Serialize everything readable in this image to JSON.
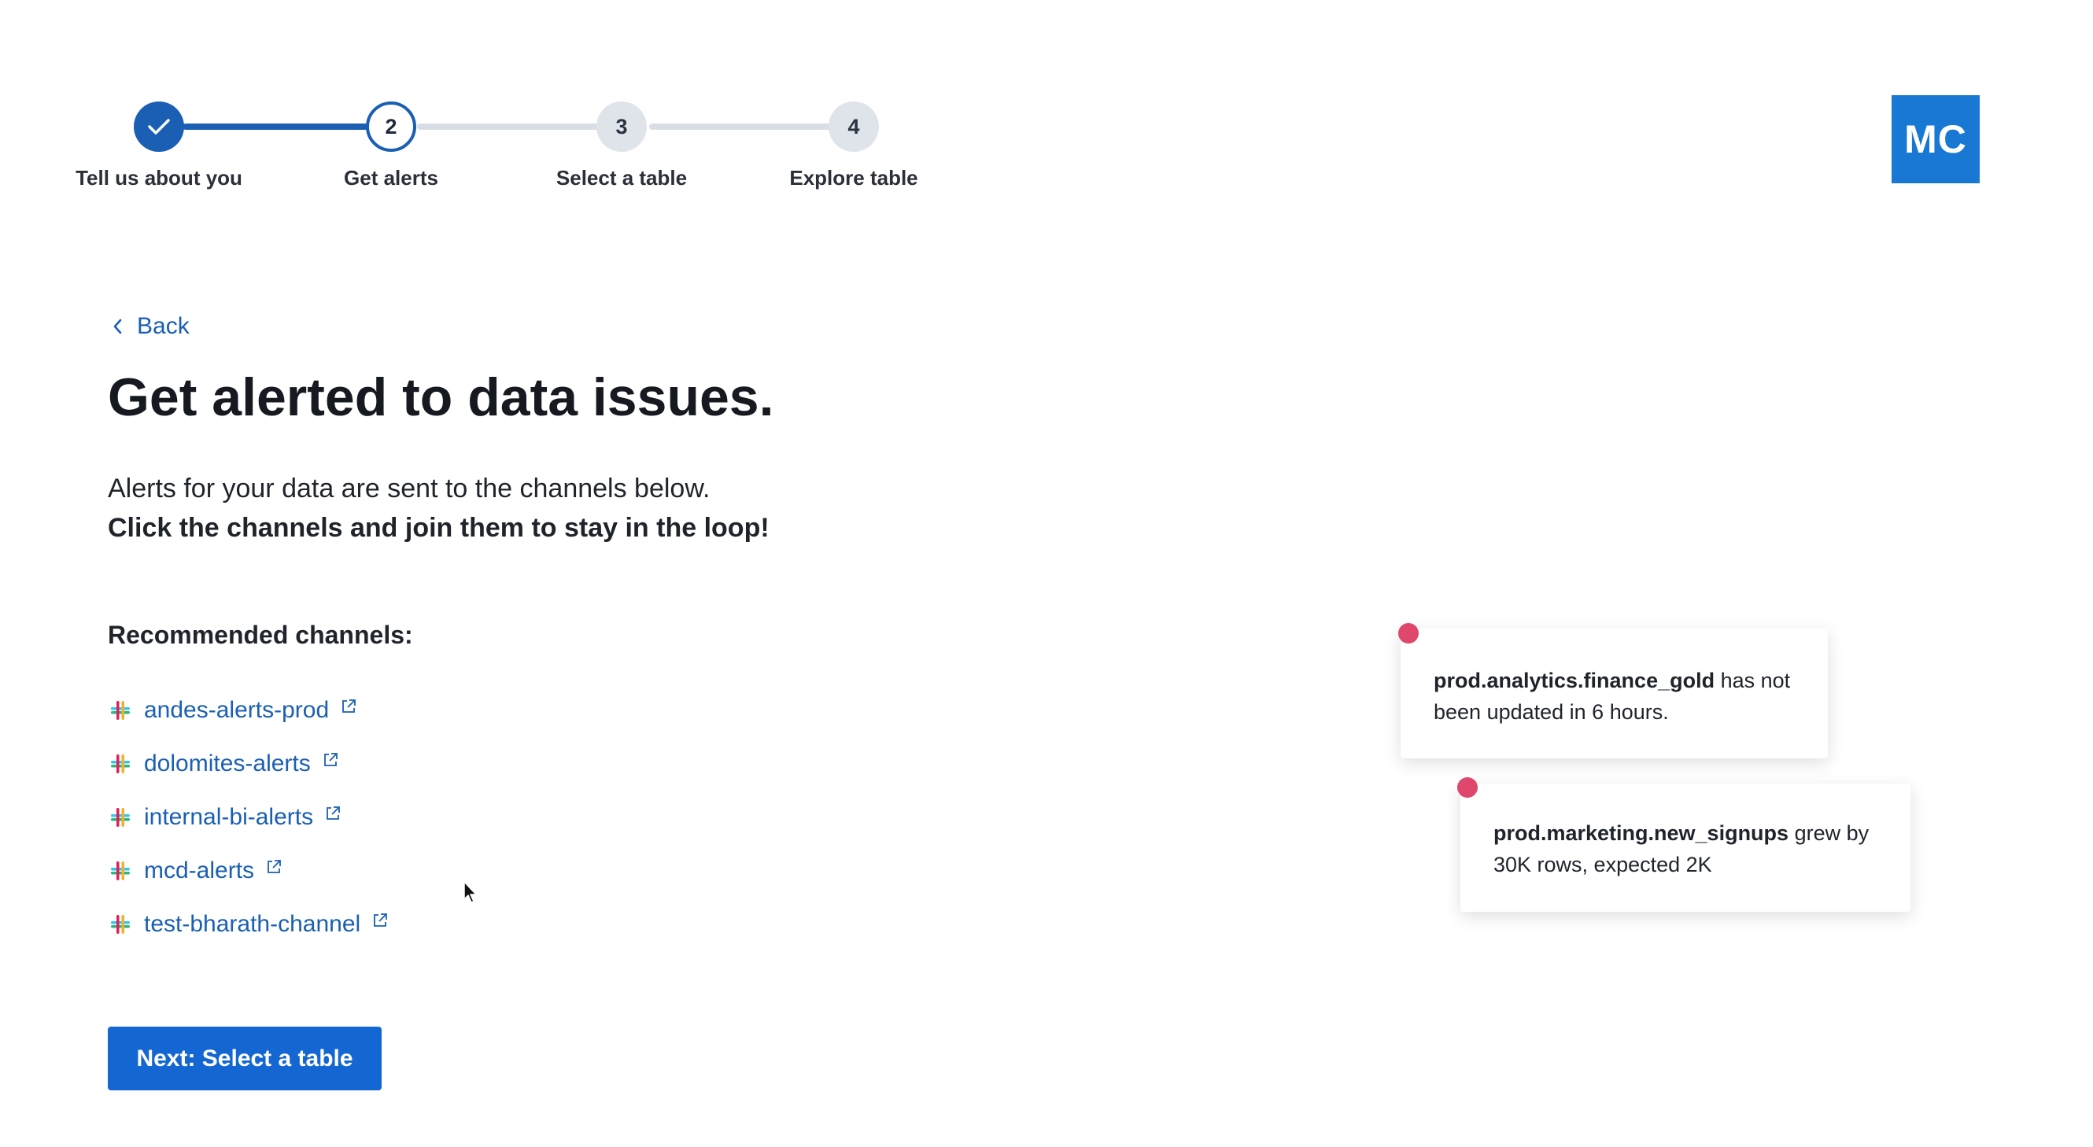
{
  "stepper": {
    "steps": [
      {
        "number": "1",
        "label": "Tell us about you",
        "state": "complete"
      },
      {
        "number": "2",
        "label": "Get alerts",
        "state": "active"
      },
      {
        "number": "3",
        "label": "Select a table",
        "state": "pending"
      },
      {
        "number": "4",
        "label": "Explore table",
        "state": "pending"
      }
    ],
    "colors": {
      "complete": "#1a5fb4",
      "pending": "#dfe3ea"
    }
  },
  "logo": {
    "text": "MC",
    "color": "#1878d3"
  },
  "back": {
    "label": "Back",
    "icon": "chevron-left-icon"
  },
  "page": {
    "title": "Get alerted to data issues.",
    "description_line1": "Alerts for your data are sent to the channels below.",
    "description_line2": "Click the channels and join them to stay in the loop!"
  },
  "channels": {
    "heading": "Recommended channels:",
    "items": [
      {
        "name": "andes-alerts-prod",
        "icon": "slack-icon",
        "link_icon": "external-link-icon"
      },
      {
        "name": "dolomites-alerts",
        "icon": "slack-icon",
        "link_icon": "external-link-icon"
      },
      {
        "name": "internal-bi-alerts",
        "icon": "slack-icon",
        "link_icon": "external-link-icon"
      },
      {
        "name": "mcd-alerts",
        "icon": "slack-icon",
        "link_icon": "external-link-icon"
      },
      {
        "name": "test-bharath-channel",
        "icon": "slack-icon",
        "link_icon": "external-link-icon"
      }
    ]
  },
  "next_button": {
    "label": "Next: Select a table",
    "color": "#1467d2"
  },
  "alerts": [
    {
      "table": "prod.analytics.finance_gold",
      "message": " has not been updated in 6 hours.",
      "dot_color": "#e0476c"
    },
    {
      "table": "prod.marketing.new_signups",
      "message": " grew by 30K rows, expected 2K",
      "dot_color": "#e0476c"
    }
  ]
}
